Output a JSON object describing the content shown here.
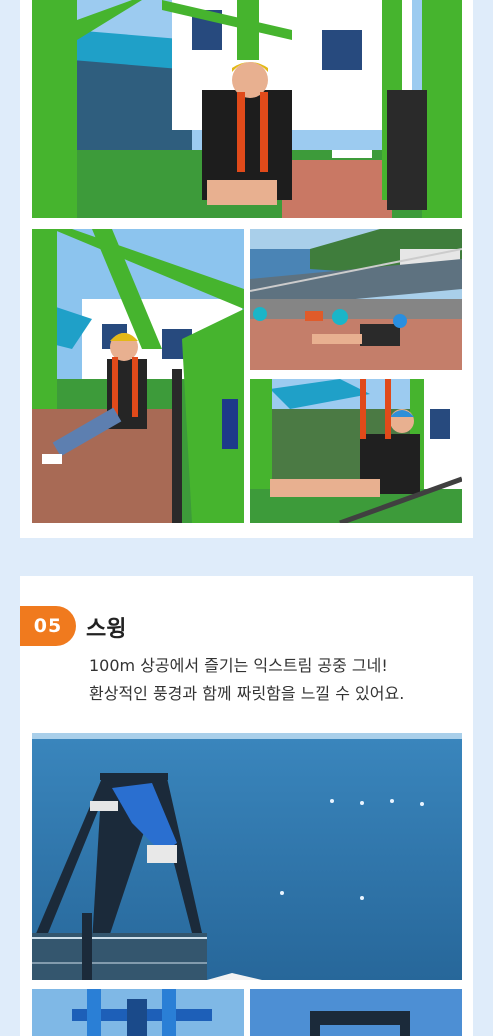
{
  "section": {
    "number": "05",
    "title": "스윙",
    "description_lines": [
      "100m 상공에서 즐기는 익스트림 공중 그네!",
      "환상적인 풍경과 함께 짜릿함을 느낄 수 있어요."
    ]
  },
  "photos": {
    "zipline_main": "zipline-rider-smiling",
    "zipline_left": "zipline-rider-seated",
    "zipline_top_right": "zipline-over-deck",
    "zipline_bottom_right": "zipline-man-blue-helmet",
    "swing_main": "swing-over-sea",
    "swing_bottom_left": "swing-blue-seats",
    "swing_bottom_right": "swing-frame"
  },
  "colors": {
    "background": "#dfecfa",
    "card": "#ffffff",
    "badge": "#f07a1e",
    "frame_green": "#4fbf2e",
    "sea": "#2f73a8",
    "sky": "#8fc6ee"
  }
}
